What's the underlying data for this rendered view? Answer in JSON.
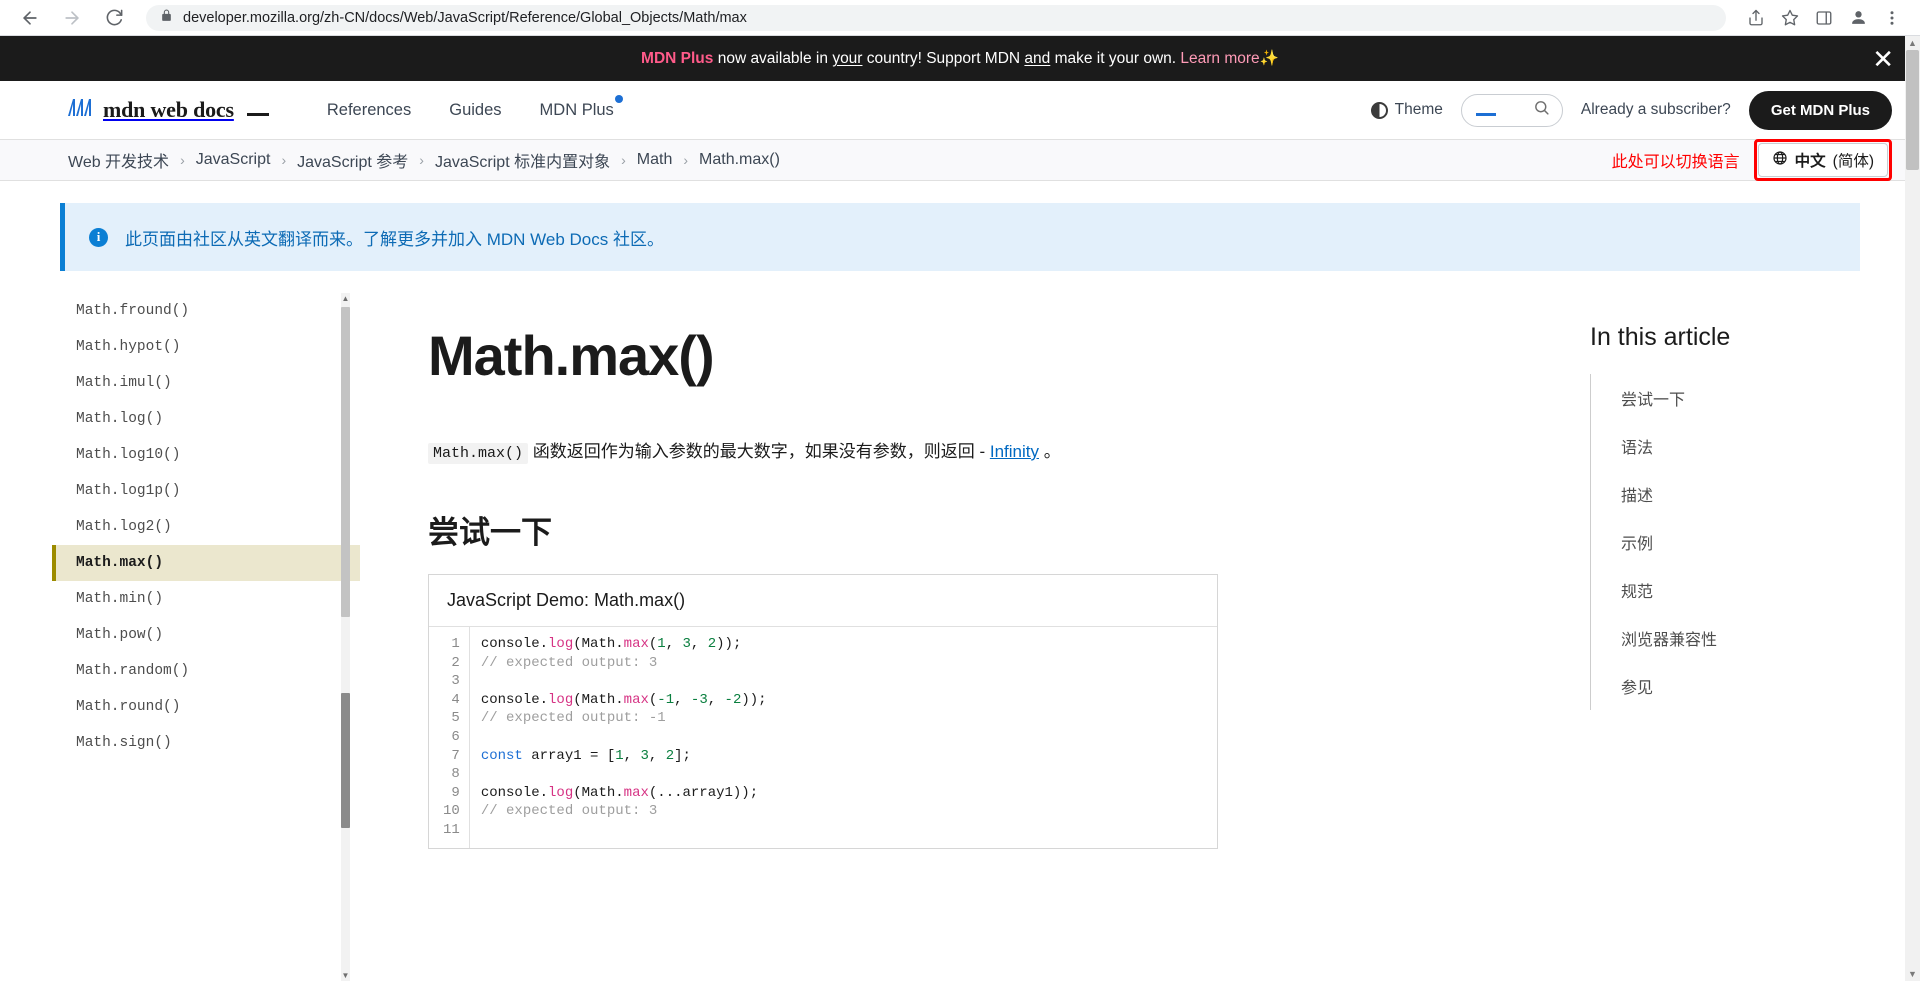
{
  "browser": {
    "url": "developer.mozilla.org/zh-CN/docs/Web/JavaScript/Reference/Global_Objects/Math/max",
    "back_label": "←",
    "forward_label": "→",
    "reload_label": "⟳",
    "lock_icon": "lock-icon",
    "share_icon": "share-icon",
    "bookmark_icon": "star-icon",
    "sidepanel_icon": "side-panel-icon",
    "profile_icon": "profile-icon",
    "menu_icon": "kebab-menu-icon"
  },
  "promo": {
    "brand": "MDN Plus",
    "part1": " now available in ",
    "your": "your",
    "part2": " country! Support MDN ",
    "and": "and",
    "part3": " make it your own. ",
    "link": "Learn more",
    "sparkle": "✨",
    "close_label": "✕"
  },
  "header": {
    "logo_text": "mdn web docs",
    "nav": [
      {
        "label": "References",
        "dot": false
      },
      {
        "label": "Guides",
        "dot": false
      },
      {
        "label": "MDN Plus",
        "dot": true
      }
    ],
    "theme_label": "Theme",
    "search_placeholder": "",
    "subscriber_text": "Already a subscriber?",
    "get_plus_label": "Get MDN Plus"
  },
  "breadcrumb": {
    "items": [
      "Web 开发技术",
      "JavaScript",
      "JavaScript 参考",
      "JavaScript 标准内置对象",
      "Math",
      "Math.max()"
    ],
    "separator": "›",
    "switch_hint": "此处可以切换语言",
    "language_label": "中文",
    "language_variant": "(简体)",
    "globe_icon": "globe-icon"
  },
  "notice": {
    "icon": "info-icon",
    "icon_glyph": "i",
    "text": "此页面由社区从英文翻译而来。了解更多并加入 MDN Web Docs 社区。"
  },
  "sidebar": {
    "items": [
      {
        "label": "Math.fround()",
        "active": false
      },
      {
        "label": "Math.hypot()",
        "active": false
      },
      {
        "label": "Math.imul()",
        "active": false
      },
      {
        "label": "Math.log()",
        "active": false
      },
      {
        "label": "Math.log10()",
        "active": false
      },
      {
        "label": "Math.log1p()",
        "active": false
      },
      {
        "label": "Math.log2()",
        "active": false
      },
      {
        "label": "Math.max()",
        "active": true
      },
      {
        "label": "Math.min()",
        "active": false
      },
      {
        "label": "Math.pow()",
        "active": false
      },
      {
        "label": "Math.random()",
        "active": false
      },
      {
        "label": "Math.round()",
        "active": false
      },
      {
        "label": "Math.sign()",
        "active": false
      }
    ],
    "scroll_up_glyph": "▲",
    "scroll_down_glyph": "▼"
  },
  "article": {
    "title": "Math.max()",
    "intro_code": "Math.max()",
    "intro_before": " 函数返回作为输入参数的最大数字，如果没有参数，则返回 - ",
    "intro_link": "Infinity",
    "intro_after": " 。",
    "section_heading": "尝试一下",
    "demo_title": "JavaScript Demo: Math.max()",
    "line_numbers": [
      "1",
      "2",
      "3",
      "4",
      "5",
      "6",
      "7",
      "8",
      "9",
      "10",
      "11"
    ],
    "code_lines": [
      [
        {
          "t": "console.",
          "c": "plain"
        },
        {
          "t": "log",
          "c": "fn"
        },
        {
          "t": "(Math.",
          "c": "plain"
        },
        {
          "t": "max",
          "c": "fn"
        },
        {
          "t": "(",
          "c": "plain"
        },
        {
          "t": "1",
          "c": "num"
        },
        {
          "t": ", ",
          "c": "plain"
        },
        {
          "t": "3",
          "c": "num"
        },
        {
          "t": ", ",
          "c": "plain"
        },
        {
          "t": "2",
          "c": "num"
        },
        {
          "t": "));",
          "c": "plain"
        }
      ],
      [
        {
          "t": "// expected output: 3",
          "c": "cmt"
        }
      ],
      [
        {
          "t": "",
          "c": "plain"
        }
      ],
      [
        {
          "t": "console.",
          "c": "plain"
        },
        {
          "t": "log",
          "c": "fn"
        },
        {
          "t": "(Math.",
          "c": "plain"
        },
        {
          "t": "max",
          "c": "fn"
        },
        {
          "t": "(",
          "c": "plain"
        },
        {
          "t": "-1",
          "c": "num"
        },
        {
          "t": ", ",
          "c": "plain"
        },
        {
          "t": "-3",
          "c": "num"
        },
        {
          "t": ", ",
          "c": "plain"
        },
        {
          "t": "-2",
          "c": "num"
        },
        {
          "t": "));",
          "c": "plain"
        }
      ],
      [
        {
          "t": "// expected output: -1",
          "c": "cmt"
        }
      ],
      [
        {
          "t": "",
          "c": "plain"
        }
      ],
      [
        {
          "t": "const",
          "c": "kw"
        },
        {
          "t": " array1 = [",
          "c": "plain"
        },
        {
          "t": "1",
          "c": "num"
        },
        {
          "t": ", ",
          "c": "plain"
        },
        {
          "t": "3",
          "c": "num"
        },
        {
          "t": ", ",
          "c": "plain"
        },
        {
          "t": "2",
          "c": "num"
        },
        {
          "t": "];",
          "c": "plain"
        }
      ],
      [
        {
          "t": "",
          "c": "plain"
        }
      ],
      [
        {
          "t": "console.",
          "c": "plain"
        },
        {
          "t": "log",
          "c": "fn"
        },
        {
          "t": "(Math.",
          "c": "plain"
        },
        {
          "t": "max",
          "c": "fn"
        },
        {
          "t": "(...array1));",
          "c": "plain"
        }
      ],
      [
        {
          "t": "// expected output: 3",
          "c": "cmt"
        }
      ],
      [
        {
          "t": "",
          "c": "plain"
        }
      ]
    ]
  },
  "toc": {
    "title": "In this article",
    "items": [
      "尝试一下",
      "语法",
      "描述",
      "示例",
      "规范",
      "浏览器兼容性",
      "参见"
    ]
  },
  "colors": {
    "accent_pink": "#ff5b8a",
    "link_blue": "#0069c2",
    "banner_bg": "#1b1b1b",
    "notice_bg": "#e3f0fb",
    "notice_border": "#0b7fd4",
    "active_sidebar": "#ebe7ce",
    "highlight_red": "#ff0000"
  }
}
